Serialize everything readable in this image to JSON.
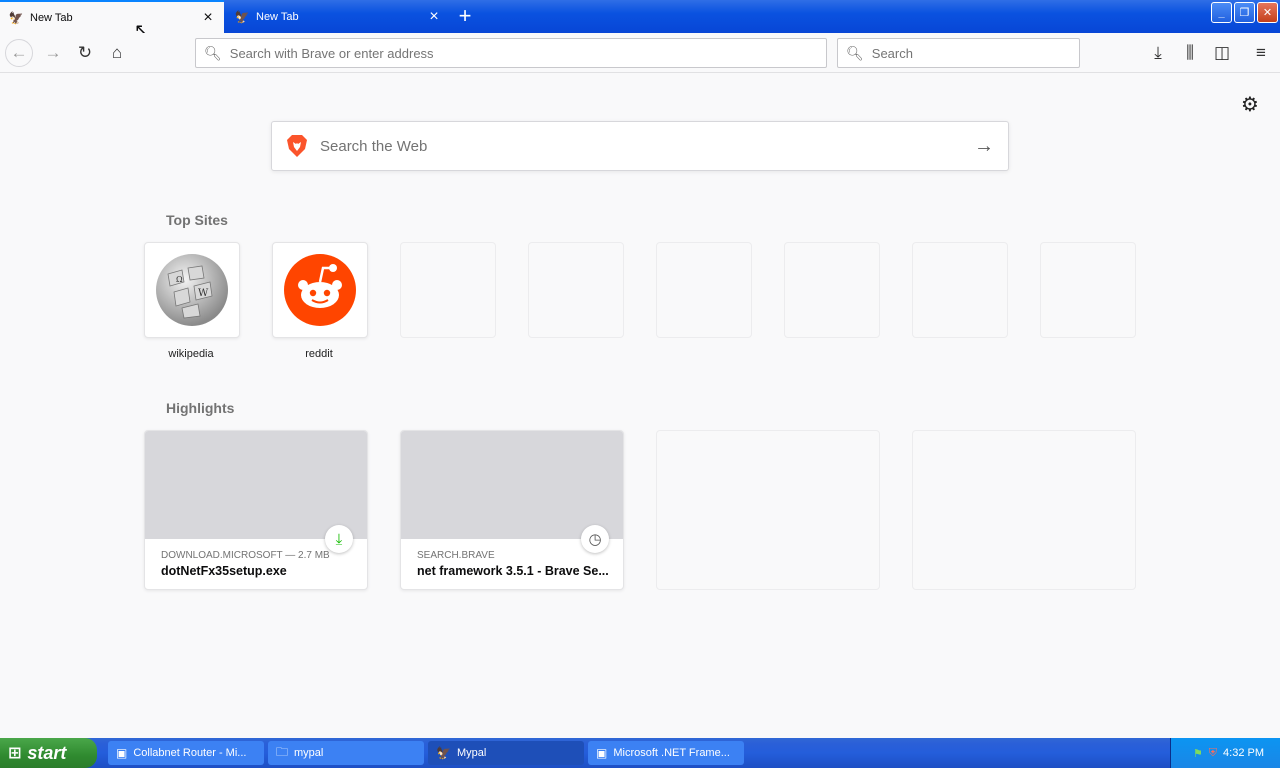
{
  "tabs": [
    {
      "title": "New Tab",
      "active": true,
      "favicon": "mypal-icon"
    },
    {
      "title": "New Tab",
      "active": false,
      "favicon": "mypal-icon"
    }
  ],
  "toolbar": {
    "url_placeholder": "Search with Brave or enter address",
    "search_placeholder": "Search"
  },
  "content": {
    "web_search_placeholder": "Search the Web",
    "top_sites_title": "Top Sites",
    "top_sites": [
      {
        "label": "wikipedia"
      },
      {
        "label": "reddit"
      }
    ],
    "highlights_title": "Highlights",
    "highlights": [
      {
        "source": "DOWNLOAD.MICROSOFT — 2.7 MB",
        "title": "dotNetFx35setup.exe",
        "badge": "download-icon"
      },
      {
        "source": "SEARCH.BRAVE",
        "title": "net framework 3.5.1 - Brave Se...",
        "badge": "clock-icon"
      }
    ]
  },
  "taskbar": {
    "start_label": "start",
    "tasks": [
      {
        "label": "Collabnet Router - Mi..."
      },
      {
        "label": "mypal"
      },
      {
        "label": "Mypal"
      },
      {
        "label": "Microsoft .NET Frame..."
      }
    ],
    "clock": "4:32 PM"
  },
  "colors": {
    "accent": "#0a84ff",
    "reddit": "#ff4500",
    "brave": "#fb542b",
    "download_green": "#12bc00"
  }
}
